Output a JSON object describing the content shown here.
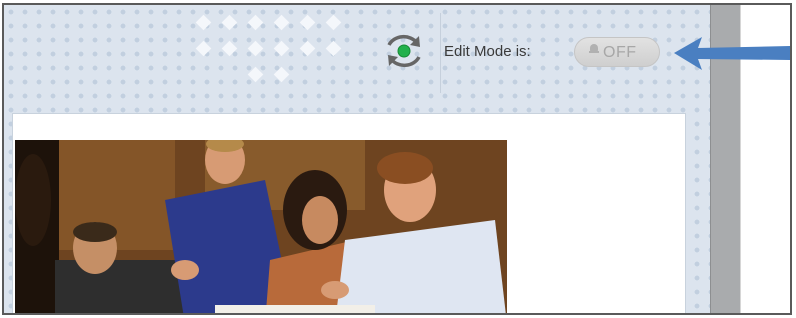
{
  "header": {
    "edit_mode_label": "Edit Mode is:",
    "edit_mode_toggle_value": "OFF",
    "refresh_icon": "sync-status-icon",
    "toggle_icon": "bell-icon"
  },
  "main": {
    "photo_subject": "group-meeting-photo"
  },
  "annotation": {
    "arrow_icon": "pointer-arrow-icon",
    "arrow_color": "#4a7fc1"
  },
  "colors": {
    "panel_background": "#dce4ee",
    "status_green": "#22b14c"
  }
}
